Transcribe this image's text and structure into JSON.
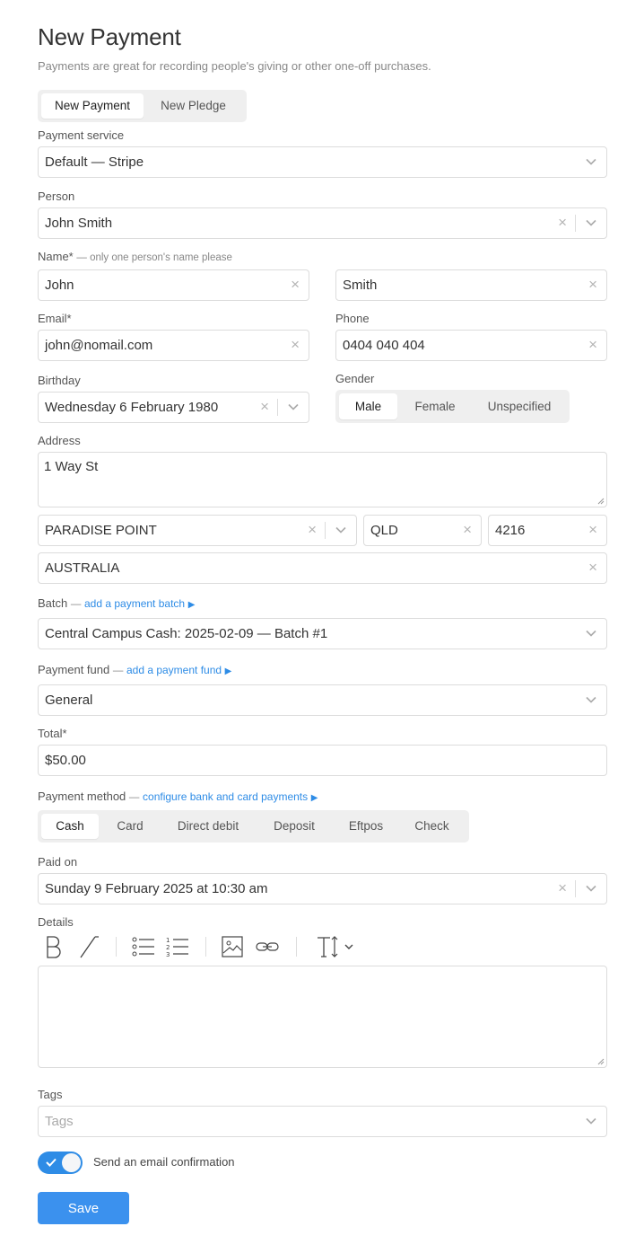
{
  "header": {
    "title": "New Payment",
    "subtitle": "Payments are great for recording people's giving or other one-off purchases."
  },
  "type_toggle": {
    "options": [
      "New Payment",
      "New Pledge"
    ],
    "selected": "New Payment"
  },
  "payment_service": {
    "label": "Payment service",
    "value": "Default — Stripe"
  },
  "person": {
    "label": "Person",
    "value": "John Smith"
  },
  "name": {
    "label": "Name*",
    "note": "— only one person's name please",
    "first": "John",
    "last": "Smith"
  },
  "email": {
    "label": "Email*",
    "value": "john@nomail.com"
  },
  "phone": {
    "label": "Phone",
    "value": "0404 040 404"
  },
  "birthday": {
    "label": "Birthday",
    "value": "Wednesday 6 February 1980"
  },
  "gender": {
    "label": "Gender",
    "options": [
      "Male",
      "Female",
      "Unspecified"
    ],
    "selected": "Male"
  },
  "address": {
    "label": "Address",
    "street": "1 Way St",
    "suburb": "PARADISE POINT",
    "state": "QLD",
    "postcode": "4216",
    "country": "AUSTRALIA"
  },
  "batch": {
    "label": "Batch",
    "dash": "—",
    "link": "add a payment batch",
    "value": "Central Campus Cash: 2025-02-09 — Batch #1"
  },
  "fund": {
    "label": "Payment fund",
    "dash": "—",
    "link": "add a payment fund",
    "value": "General"
  },
  "total": {
    "label": "Total*",
    "value": "$50.00"
  },
  "method": {
    "label": "Payment method",
    "dash": "—",
    "link": "configure bank and card payments",
    "options": [
      "Cash",
      "Card",
      "Direct debit",
      "Deposit",
      "Eftpos",
      "Check"
    ],
    "selected": "Cash"
  },
  "paid_on": {
    "label": "Paid on",
    "value": "Sunday 9 February 2025 at 10:30 am"
  },
  "details": {
    "label": "Details",
    "toolbar_icons": [
      "bold-icon",
      "italic-icon",
      "bullet-list-icon",
      "numbered-list-icon",
      "image-icon",
      "link-icon",
      "text-size-icon"
    ]
  },
  "tags": {
    "label": "Tags",
    "placeholder": "Tags"
  },
  "email_confirmation": {
    "label": "Send an email confirmation",
    "enabled": true
  },
  "save_label": "Save",
  "colors": {
    "accent": "#2e8ce6",
    "button": "#3b91ee",
    "border": "#dcdcdc"
  }
}
